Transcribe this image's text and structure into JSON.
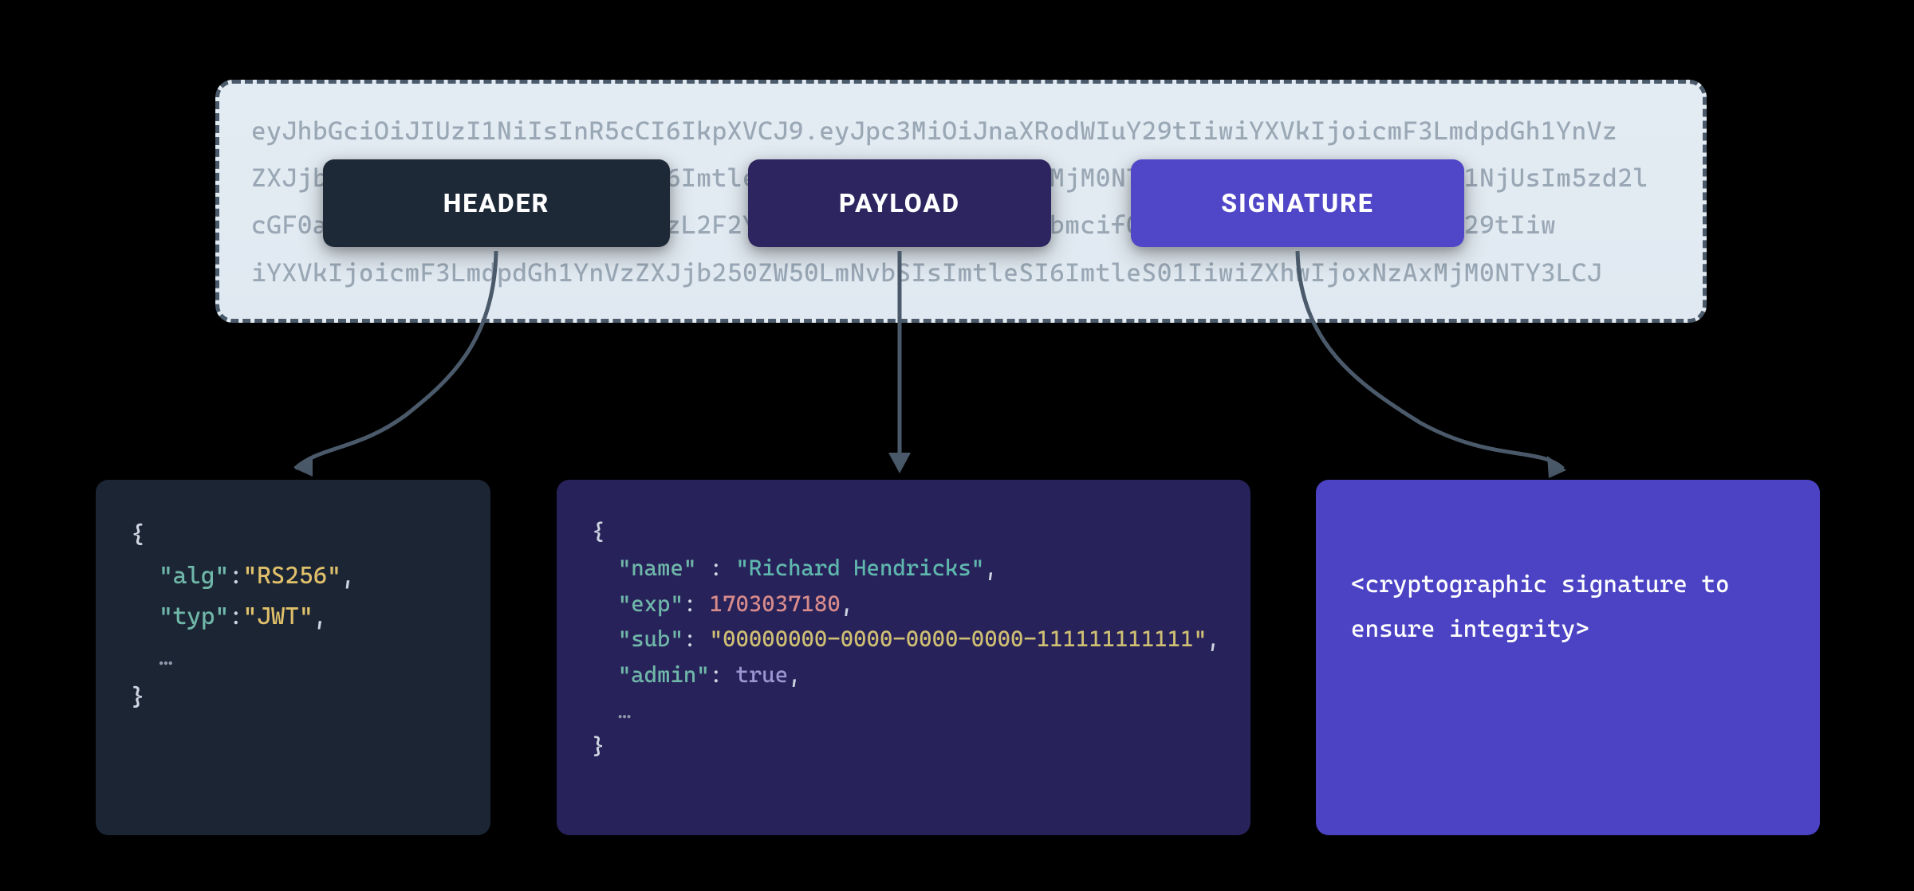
{
  "token": {
    "line1": "eyJhbGciOiJIUzI1NiIsInR5cCI6IkpXVCJ9.eyJpc3MiOiJnaXRodWIuY29tIiwiYXVkIjoicmF3LmdpdGh1YnVz",
    "line2": "ZXJjb250ZW50LmNvbSIsImtleSI6ImtleS01IiwiZXhwIjoxNzAxMjM0NTY3LCJuYmYiOjE3MDEyMzQ1NjUsIm5zd2l",
    "line3": "cGF0aCI6Ii91c2Vycy8xMjkyMDEzL2F2YXRhcnMvMTI5MjAxMy5wbmcifQ.XyLWQyNeyJnaXRodWIuY29tIiw",
    "line4": "iYXVkIjoicmF3LmdpdGh1YnVzZXJjb250ZW50LmNvbSIsImtleSI6ImtleS01IiwiZXhwIjoxNzAxMjM0NTY3LCJ"
  },
  "chips": {
    "header": "HEADER",
    "payload": "PAYLOAD",
    "signature": "SIGNATURE"
  },
  "header_panel": {
    "alg_key": "\"alg\"",
    "alg_val": "\"RS256\"",
    "typ_key": "\"typ\"",
    "typ_val": "\"JWT\"",
    "ellipsis": "…"
  },
  "payload_panel": {
    "name_key": "\"name\"",
    "name_val": "\"Richard Hendricks\"",
    "exp_key": "\"exp\"",
    "exp_val": "1703037180",
    "sub_key": "\"sub\"",
    "sub_val": "\"00000000-0000-0000-0000-111111111111\"",
    "admin_key": "\"admin\"",
    "admin_val": "true",
    "ellipsis": "…"
  },
  "signature_panel": {
    "text": "<cryptographic signature to ensure integrity>"
  }
}
